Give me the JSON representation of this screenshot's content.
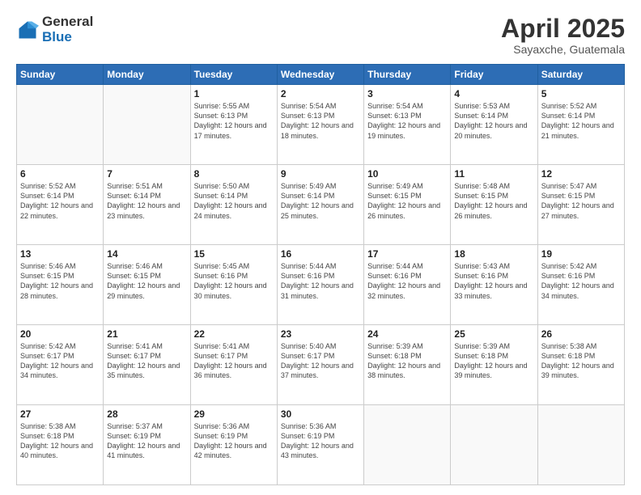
{
  "logo": {
    "general": "General",
    "blue": "Blue"
  },
  "header": {
    "title": "April 2025",
    "subtitle": "Sayaxche, Guatemala"
  },
  "weekdays": [
    "Sunday",
    "Monday",
    "Tuesday",
    "Wednesday",
    "Thursday",
    "Friday",
    "Saturday"
  ],
  "weeks": [
    [
      {
        "day": "",
        "info": ""
      },
      {
        "day": "",
        "info": ""
      },
      {
        "day": "1",
        "info": "Sunrise: 5:55 AM\nSunset: 6:13 PM\nDaylight: 12 hours and 17 minutes."
      },
      {
        "day": "2",
        "info": "Sunrise: 5:54 AM\nSunset: 6:13 PM\nDaylight: 12 hours and 18 minutes."
      },
      {
        "day": "3",
        "info": "Sunrise: 5:54 AM\nSunset: 6:13 PM\nDaylight: 12 hours and 19 minutes."
      },
      {
        "day": "4",
        "info": "Sunrise: 5:53 AM\nSunset: 6:14 PM\nDaylight: 12 hours and 20 minutes."
      },
      {
        "day": "5",
        "info": "Sunrise: 5:52 AM\nSunset: 6:14 PM\nDaylight: 12 hours and 21 minutes."
      }
    ],
    [
      {
        "day": "6",
        "info": "Sunrise: 5:52 AM\nSunset: 6:14 PM\nDaylight: 12 hours and 22 minutes."
      },
      {
        "day": "7",
        "info": "Sunrise: 5:51 AM\nSunset: 6:14 PM\nDaylight: 12 hours and 23 minutes."
      },
      {
        "day": "8",
        "info": "Sunrise: 5:50 AM\nSunset: 6:14 PM\nDaylight: 12 hours and 24 minutes."
      },
      {
        "day": "9",
        "info": "Sunrise: 5:49 AM\nSunset: 6:14 PM\nDaylight: 12 hours and 25 minutes."
      },
      {
        "day": "10",
        "info": "Sunrise: 5:49 AM\nSunset: 6:15 PM\nDaylight: 12 hours and 26 minutes."
      },
      {
        "day": "11",
        "info": "Sunrise: 5:48 AM\nSunset: 6:15 PM\nDaylight: 12 hours and 26 minutes."
      },
      {
        "day": "12",
        "info": "Sunrise: 5:47 AM\nSunset: 6:15 PM\nDaylight: 12 hours and 27 minutes."
      }
    ],
    [
      {
        "day": "13",
        "info": "Sunrise: 5:46 AM\nSunset: 6:15 PM\nDaylight: 12 hours and 28 minutes."
      },
      {
        "day": "14",
        "info": "Sunrise: 5:46 AM\nSunset: 6:15 PM\nDaylight: 12 hours and 29 minutes."
      },
      {
        "day": "15",
        "info": "Sunrise: 5:45 AM\nSunset: 6:16 PM\nDaylight: 12 hours and 30 minutes."
      },
      {
        "day": "16",
        "info": "Sunrise: 5:44 AM\nSunset: 6:16 PM\nDaylight: 12 hours and 31 minutes."
      },
      {
        "day": "17",
        "info": "Sunrise: 5:44 AM\nSunset: 6:16 PM\nDaylight: 12 hours and 32 minutes."
      },
      {
        "day": "18",
        "info": "Sunrise: 5:43 AM\nSunset: 6:16 PM\nDaylight: 12 hours and 33 minutes."
      },
      {
        "day": "19",
        "info": "Sunrise: 5:42 AM\nSunset: 6:16 PM\nDaylight: 12 hours and 34 minutes."
      }
    ],
    [
      {
        "day": "20",
        "info": "Sunrise: 5:42 AM\nSunset: 6:17 PM\nDaylight: 12 hours and 34 minutes."
      },
      {
        "day": "21",
        "info": "Sunrise: 5:41 AM\nSunset: 6:17 PM\nDaylight: 12 hours and 35 minutes."
      },
      {
        "day": "22",
        "info": "Sunrise: 5:41 AM\nSunset: 6:17 PM\nDaylight: 12 hours and 36 minutes."
      },
      {
        "day": "23",
        "info": "Sunrise: 5:40 AM\nSunset: 6:17 PM\nDaylight: 12 hours and 37 minutes."
      },
      {
        "day": "24",
        "info": "Sunrise: 5:39 AM\nSunset: 6:18 PM\nDaylight: 12 hours and 38 minutes."
      },
      {
        "day": "25",
        "info": "Sunrise: 5:39 AM\nSunset: 6:18 PM\nDaylight: 12 hours and 39 minutes."
      },
      {
        "day": "26",
        "info": "Sunrise: 5:38 AM\nSunset: 6:18 PM\nDaylight: 12 hours and 39 minutes."
      }
    ],
    [
      {
        "day": "27",
        "info": "Sunrise: 5:38 AM\nSunset: 6:18 PM\nDaylight: 12 hours and 40 minutes."
      },
      {
        "day": "28",
        "info": "Sunrise: 5:37 AM\nSunset: 6:19 PM\nDaylight: 12 hours and 41 minutes."
      },
      {
        "day": "29",
        "info": "Sunrise: 5:36 AM\nSunset: 6:19 PM\nDaylight: 12 hours and 42 minutes."
      },
      {
        "day": "30",
        "info": "Sunrise: 5:36 AM\nSunset: 6:19 PM\nDaylight: 12 hours and 43 minutes."
      },
      {
        "day": "",
        "info": ""
      },
      {
        "day": "",
        "info": ""
      },
      {
        "day": "",
        "info": ""
      }
    ]
  ]
}
